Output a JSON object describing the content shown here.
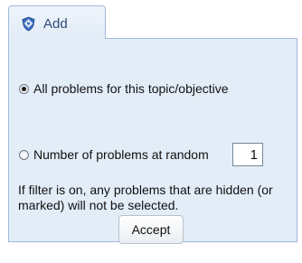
{
  "tab": {
    "label": "Add",
    "icon": "gear-shield-icon"
  },
  "options": {
    "all_problems": {
      "label": "All problems for this topic/objective",
      "selected": true
    },
    "random": {
      "label": "Number of problems at random",
      "selected": false,
      "count_value": "1"
    }
  },
  "note": "If filter is on, any problems that are hidden (or marked) will not be selected.",
  "accept_label": "Accept",
  "colors": {
    "panel_bg": "#e3edf8",
    "border": "#9fb9d6",
    "tab_text": "#2e4a78"
  }
}
